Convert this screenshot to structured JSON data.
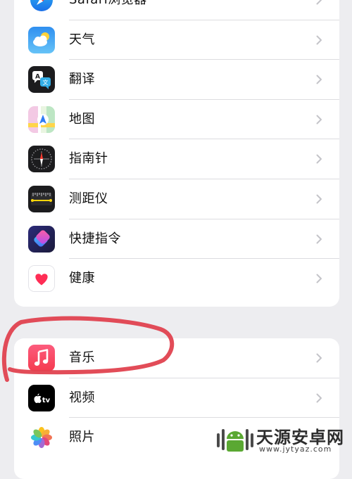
{
  "groups": [
    {
      "items": [
        {
          "label": "Safari浏览器",
          "icon": "safari-icon"
        },
        {
          "label": "天气",
          "icon": "weather-icon"
        },
        {
          "label": "翻译",
          "icon": "translate-icon"
        },
        {
          "label": "地图",
          "icon": "maps-icon"
        },
        {
          "label": "指南针",
          "icon": "compass-icon"
        },
        {
          "label": "测距仪",
          "icon": "measure-icon"
        },
        {
          "label": "快捷指令",
          "icon": "shortcuts-icon"
        },
        {
          "label": "健康",
          "icon": "health-icon"
        }
      ]
    },
    {
      "items": [
        {
          "label": "音乐",
          "icon": "music-icon"
        },
        {
          "label": "视频",
          "icon": "tv-icon"
        },
        {
          "label": "照片",
          "icon": "photos-icon"
        }
      ]
    }
  ],
  "watermark": {
    "title": "天源安卓网",
    "url": "www.jytyaz.com"
  },
  "colors": {
    "background": "#ededf0",
    "annotation": "#e0424f",
    "chevron": "#c4c4c9"
  }
}
